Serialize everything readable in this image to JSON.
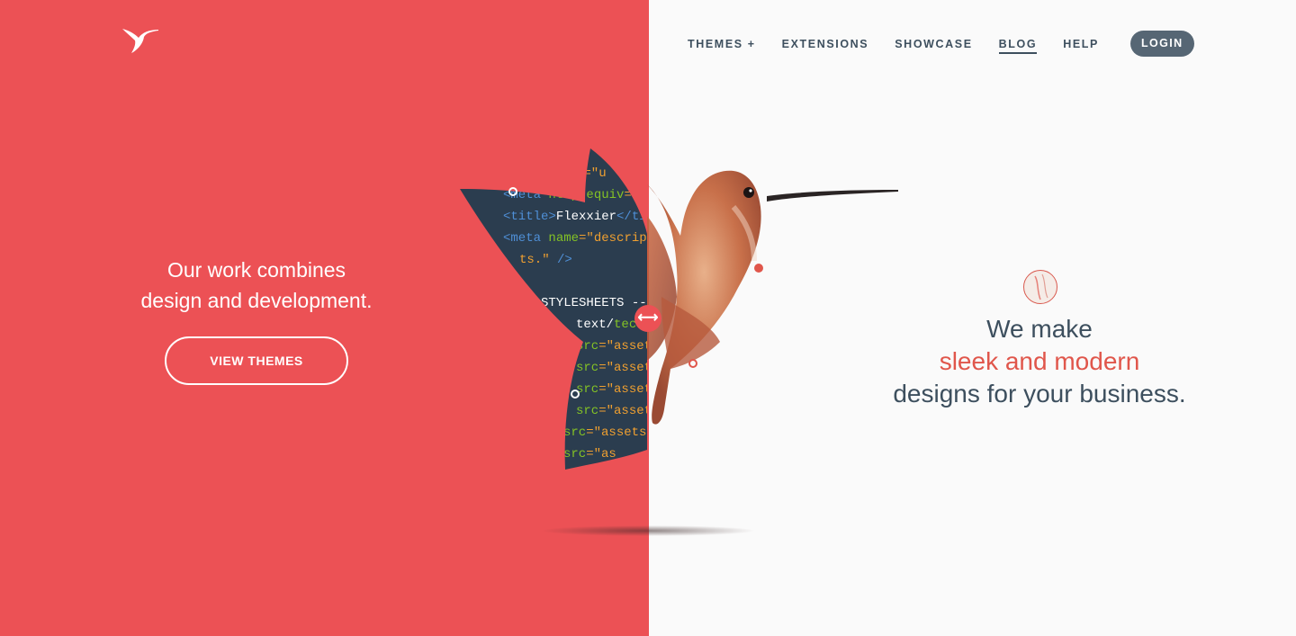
{
  "nav": {
    "items": [
      {
        "label": "THEMES +",
        "active": false
      },
      {
        "label": "EXTENSIONS",
        "active": false
      },
      {
        "label": "SHOWCASE",
        "active": false
      },
      {
        "label": "BLOG",
        "active": true
      },
      {
        "label": "HELP",
        "active": false
      }
    ],
    "login_label": "LOGIN"
  },
  "hero_left": {
    "line1": "Our work combines",
    "line2": "design and development.",
    "button_label": "VIEW THEMES"
  },
  "hero_right": {
    "prefix": "We make ",
    "accent": "sleek and modern",
    "line2": "designs for your business."
  },
  "code_lines": [
    {
      "parts": [
        {
          "t": "t",
          "c": "attr"
        },
        {
          "t": "=\"u",
          "c": "str"
        }
      ]
    },
    {
      "parts": [
        {
          "t": "<meta ",
          "c": "tag"
        },
        {
          "t": "http-equiv",
          "c": "attr"
        },
        {
          "t": "=\"X",
          "c": "str"
        }
      ]
    },
    {
      "parts": [
        {
          "t": "<title>",
          "c": "tag"
        },
        {
          "t": "Flexxier",
          "c": "plain"
        },
        {
          "t": "</ti",
          "c": "tag"
        }
      ]
    },
    {
      "parts": [
        {
          "t": "<meta ",
          "c": "tag"
        },
        {
          "t": "name",
          "c": "attr"
        },
        {
          "t": "=\"descrip",
          "c": "str"
        }
      ]
    },
    {
      "parts": [
        {
          "t": "ts.\" ",
          "c": "str"
        },
        {
          "t": "/>",
          "c": "tag"
        }
      ]
    },
    {
      "parts": [
        {
          "t": "",
          "c": "plain"
        }
      ]
    },
    {
      "parts": [
        {
          "t": "<!-- STYLESHEETS --",
          "c": "plain"
        }
      ]
    },
    {
      "parts": [
        {
          "t": "text/",
          "c": "plain"
        },
        {
          "t": "tech",
          "c": "attr"
        }
      ]
    },
    {
      "parts": [
        {
          "t": "src",
          "c": "attr"
        },
        {
          "t": "=\"assets",
          "c": "str"
        }
      ]
    },
    {
      "parts": [
        {
          "t": "src",
          "c": "attr"
        },
        {
          "t": "=\"assets",
          "c": "str"
        }
      ]
    },
    {
      "parts": [
        {
          "t": "src",
          "c": "attr"
        },
        {
          "t": "=\"assets",
          "c": "str"
        }
      ]
    },
    {
      "parts": [
        {
          "t": "src",
          "c": "attr"
        },
        {
          "t": "=\"assets",
          "c": "str"
        }
      ]
    },
    {
      "parts": [
        {
          "t": "src",
          "c": "attr"
        },
        {
          "t": "=\"assets",
          "c": "str"
        }
      ]
    },
    {
      "parts": [
        {
          "t": "src",
          "c": "attr"
        },
        {
          "t": "=\"as",
          "c": "str"
        }
      ]
    }
  ],
  "colors": {
    "brand_red": "#ec5155",
    "accent_text": "#e0564b",
    "dark_text": "#3d4f5e",
    "login_bg": "#566674",
    "code_bg": "#2b3d4f",
    "code_tag": "#4f8fd6",
    "code_attr": "#84c225",
    "code_str": "#f0a030",
    "code_plain": "#ffffff"
  },
  "icons": {
    "logo": "hummingbird-logo-icon",
    "handle": "left-right-arrows-icon",
    "badge": "globe-icon"
  }
}
